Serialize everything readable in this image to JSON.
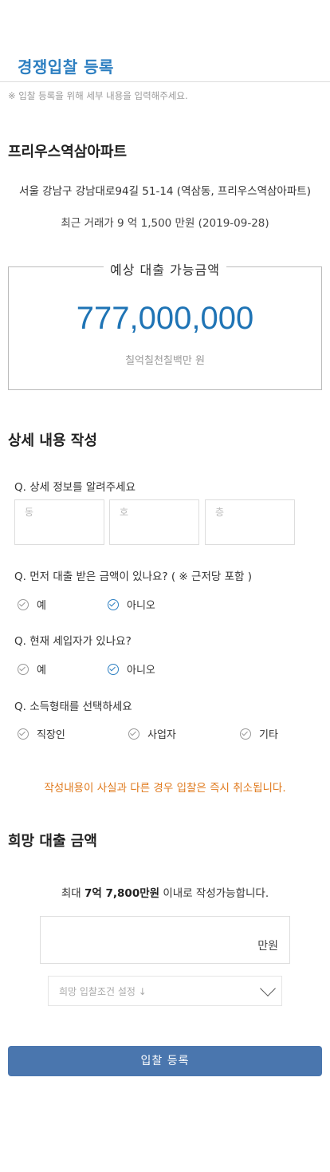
{
  "header": {
    "title": "경쟁입찰 등록",
    "notice": "※ 입찰 등록을 위해 세부 내용을 입력해주세요."
  },
  "property": {
    "name": "프리우스역삼아파트",
    "address": "서울 강남구 강남대로94길 51-14 (역삼동, 프리우스역삼아파트)",
    "recent_price": "최근 거래가 9 억 1,500 만원 (2019-09-28)"
  },
  "loan": {
    "title": "예상 대출 가능금액",
    "amount": "777,000,000",
    "amount_korean": "칠억칠천칠백만 원"
  },
  "details": {
    "section_title": "상세 내용 작성",
    "q1": "Q. 상세 정보를 알려주세요",
    "placeholders": {
      "dong": "동",
      "ho": "호",
      "floor": "층"
    },
    "q2": "Q. 먼저 대출 받은 금액이 있나요? ( ※ 근저당 포함 )",
    "q2_options": [
      "예",
      "아니오"
    ],
    "q2_selected": "아니오",
    "q3": "Q. 현재 세입자가 있나요?",
    "q3_options": [
      "예",
      "아니오"
    ],
    "q3_selected": "아니오",
    "q4": "Q. 소득형태를 선택하세요",
    "q4_options": [
      "직장인",
      "사업자",
      "기타"
    ]
  },
  "warning": "작성내용이 사실과 다른 경우 입찰은 즉시 취소됩니다.",
  "desired": {
    "section_title": "희망 대출 금액",
    "max_prefix": "최대 ",
    "max_amount": "7억 7,800만원",
    "max_suffix": " 이내로 작성가능합니다.",
    "unit": "만원",
    "condition_placeholder": "희망 입찰조건 설정 ↓"
  },
  "submit_label": "입찰 등록",
  "colors": {
    "accent": "#2d7fc1",
    "button": "#4a76ae",
    "warning": "#e07b1f"
  }
}
